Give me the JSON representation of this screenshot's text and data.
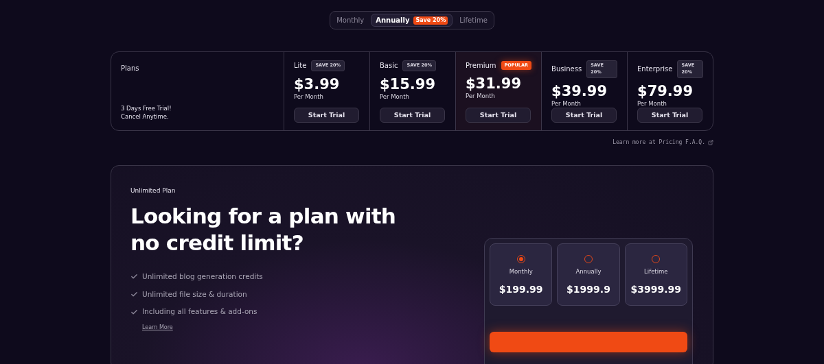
{
  "billing_toggle": [
    {
      "label": "Monthly",
      "selected": false
    },
    {
      "label": "Annually",
      "selected": true,
      "badge": "Save 20%"
    },
    {
      "label": "Lifetime",
      "selected": false
    }
  ],
  "plans_table": {
    "heading": "Plans",
    "trial_note": [
      "3 Days Free Trial!",
      "Cancel Anytime."
    ],
    "plans": [
      {
        "name": "Lite",
        "badge": {
          "text": "SAVE 20%",
          "kind": "save"
        },
        "price": "$3.99",
        "period": "Per Month",
        "button": "Start Trial"
      },
      {
        "name": "Basic",
        "badge": {
          "text": "SAVE 20%",
          "kind": "save"
        },
        "price": "$15.99",
        "period": "Per Month",
        "button": "Start Trial"
      },
      {
        "name": "Premium",
        "badge": {
          "text": "POPULAR",
          "kind": "popular"
        },
        "price": "$31.99",
        "period": "Per Month",
        "button": "Start Trial"
      },
      {
        "name": "Business",
        "badge": {
          "text": "SAVE 20%",
          "kind": "save"
        },
        "price": "$39.99",
        "period": "Per Month",
        "button": "Start Trial"
      },
      {
        "name": "Enterprise",
        "badge": {
          "text": "SAVE 20%",
          "kind": "save"
        },
        "price": "$79.99",
        "period": "Per Month",
        "button": "Start Trial"
      }
    ]
  },
  "faq_link": "Learn more at Pricing F.A.Q.",
  "unlimited": {
    "eyebrow": "Unlimited Plan",
    "headline": "Looking for a plan with no credit limit?",
    "features": [
      "Unlimited blog generation credits",
      "Unlimited file size & duration",
      "Including all features & add-ons"
    ],
    "learn_more": "Learn More",
    "options": [
      {
        "label": "Monthly",
        "price": "$199.99",
        "selected": true
      },
      {
        "label": "Annually",
        "price": "$1999.9",
        "selected": false
      },
      {
        "label": "Lifetime",
        "price": "$3999.99",
        "selected": false
      }
    ]
  }
}
